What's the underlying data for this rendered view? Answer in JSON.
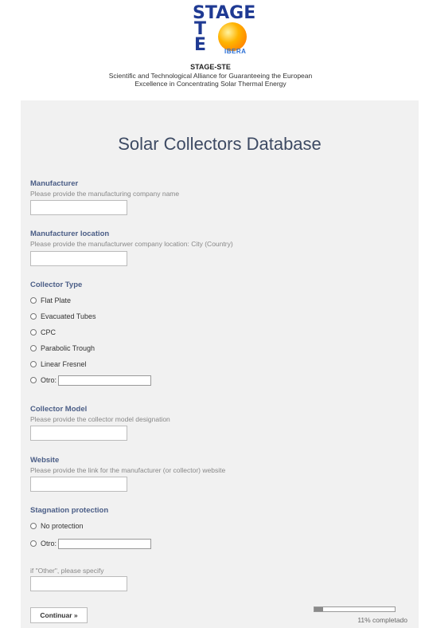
{
  "header": {
    "logo_top": "STAGE",
    "logo_s": "S",
    "logo_t": "T",
    "logo_e": "E",
    "logo_iberia": "IBERA",
    "org_title": "STAGE-STE",
    "org_sub_line1": "Scientific and Technological Alliance for Guaranteeing the European",
    "org_sub_line2": "Excellence in Concentrating Solar Thermal Energy"
  },
  "form": {
    "title": "Solar Collectors Database",
    "manufacturer": {
      "label": "Manufacturer",
      "help": "Please provide the manufacturing company name",
      "value": ""
    },
    "location": {
      "label": "Manufacturer location",
      "help": "Please provide the manufacturwer company location: City (Country)",
      "value": ""
    },
    "collector_type": {
      "label": "Collector Type",
      "options": [
        "Flat Plate",
        "Evacuated Tubes",
        "CPC",
        "Parabolic Trough",
        "Linear Fresnel",
        "Otro:"
      ]
    },
    "model": {
      "label": "Collector Model",
      "help": "Please provide the collector model designation",
      "value": ""
    },
    "website": {
      "label": "Website",
      "help": "Please provide the link for the manufacturer (or collector) website",
      "value": ""
    },
    "stagnation": {
      "label": "Stagnation protection",
      "options": [
        "No protection",
        "Otro:"
      ]
    },
    "other_specify": {
      "help": "if \"Other\", please specify",
      "value": ""
    },
    "continue_label": "Continuar »",
    "progress_percent": 11,
    "progress_text": "11% completado"
  }
}
